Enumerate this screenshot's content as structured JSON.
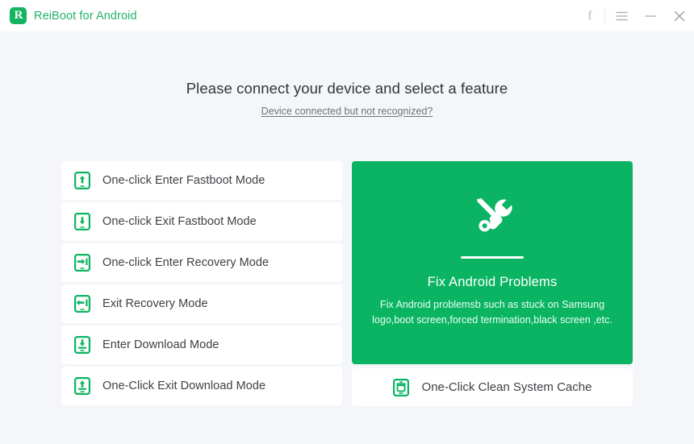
{
  "window": {
    "app_title": "ReiBoot for Android",
    "logo_letter": "R",
    "controls": {
      "facebook": "f",
      "menu_icon": "hamburger-menu-icon",
      "minimize_icon": "minimize-icon",
      "close_icon": "close-icon"
    }
  },
  "main": {
    "headline": "Please connect your device and select a feature",
    "sub_link": "Device connected but not recognized?"
  },
  "mode_list": [
    {
      "label": "One-click Enter Fastboot Mode",
      "icon": "phone-arrow-up-icon"
    },
    {
      "label": "One-click Exit Fastboot Mode",
      "icon": "phone-arrow-down-icon"
    },
    {
      "label": "One-click Enter Recovery Mode",
      "icon": "phone-arrow-in-icon"
    },
    {
      "label": "Exit Recovery Mode",
      "icon": "phone-arrow-out-icon"
    },
    {
      "label": "Enter Download Mode",
      "icon": "phone-download-icon"
    },
    {
      "label": "One-Click Exit Download Mode",
      "icon": "phone-upload-icon"
    }
  ],
  "feature_panel": {
    "icon": "wrench-screwdriver-icon",
    "title": "Fix Android Problems",
    "description": "Fix Android problemsb such as stuck on Samsung logo,boot screen,forced termination,black screen ,etc."
  },
  "cache_card": {
    "label": "One-Click Clean System Cache",
    "icon": "phone-trash-icon"
  },
  "colors": {
    "brand_green": "#0bb463",
    "logo_green": "#16b462",
    "page_background": "#f5f6fa",
    "card_background": "#ffffff",
    "text_primary": "#3d4045",
    "text_muted": "#6f7279"
  }
}
